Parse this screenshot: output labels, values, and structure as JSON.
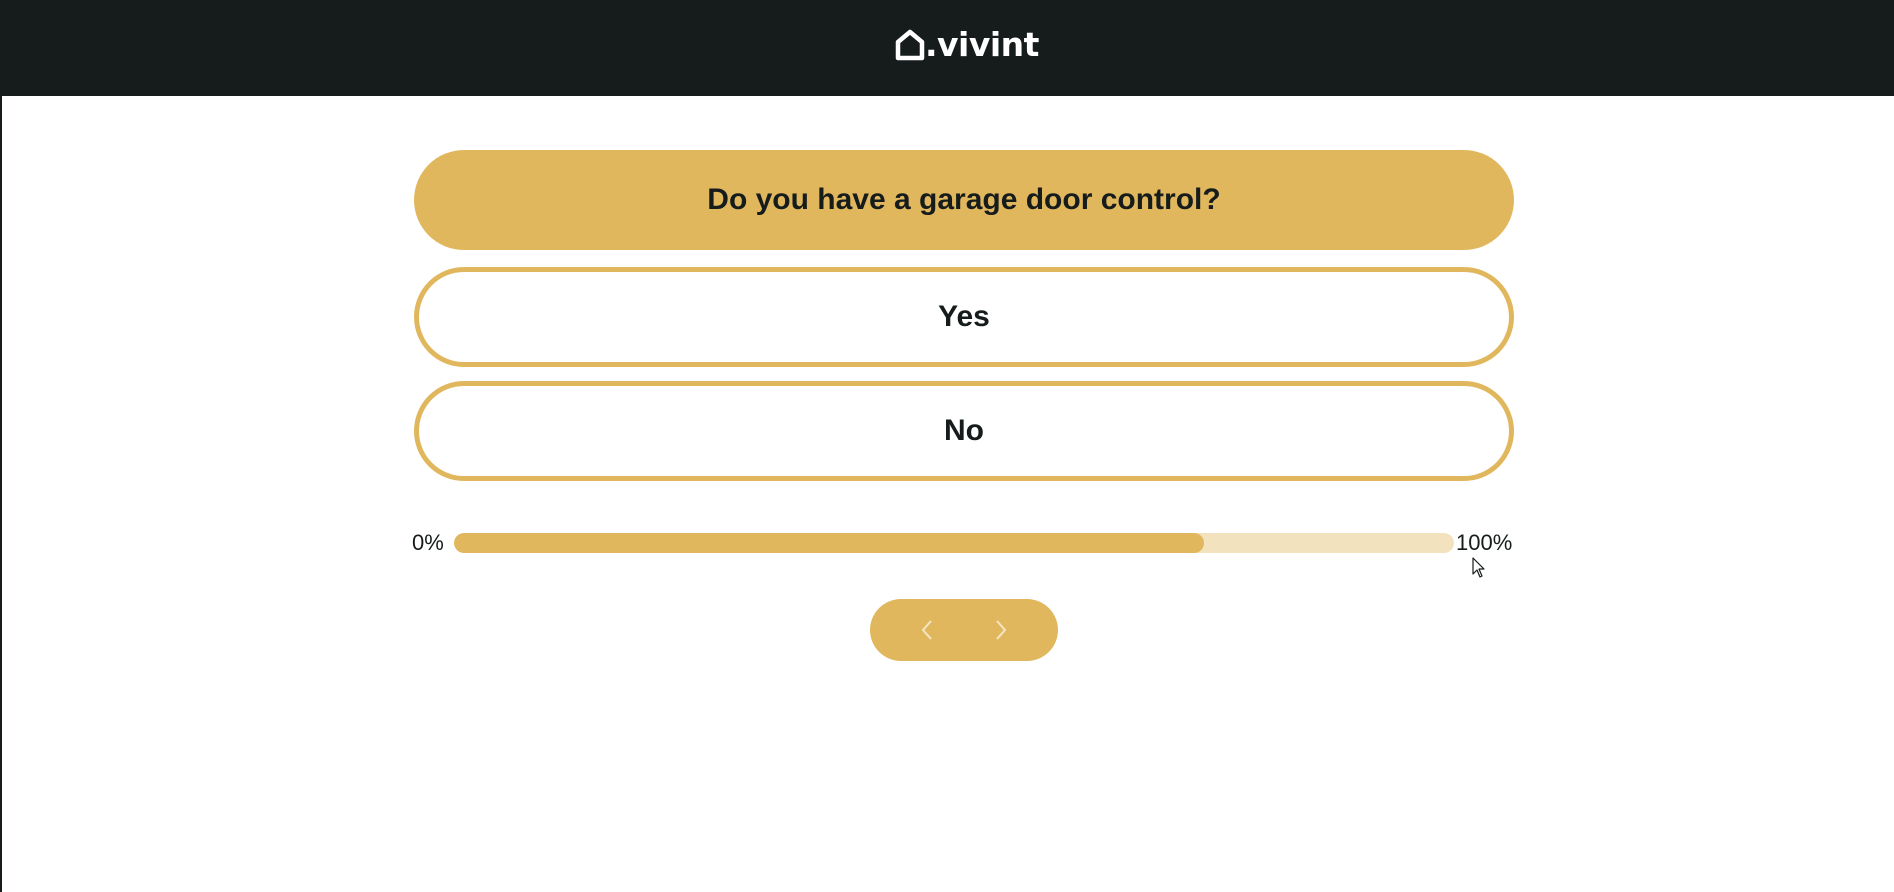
{
  "header": {
    "logo_text": ".vivint",
    "logo_icon": "home-outline-icon"
  },
  "quiz": {
    "question": "Do you have a garage door control?",
    "answers": [
      {
        "label": "Yes"
      },
      {
        "label": "No"
      }
    ]
  },
  "progress": {
    "min_label": "0%",
    "max_label": "100%",
    "value_fraction": 0.75
  },
  "navigation": {
    "prev_icon": "chevron-left-icon",
    "next_icon": "chevron-right-icon"
  },
  "colors": {
    "header_bg": "#161c1c",
    "accent": "#e1b75d",
    "accent_light": "#f2e3be",
    "text": "#161c1c",
    "chevron": "#f3e6c4"
  }
}
